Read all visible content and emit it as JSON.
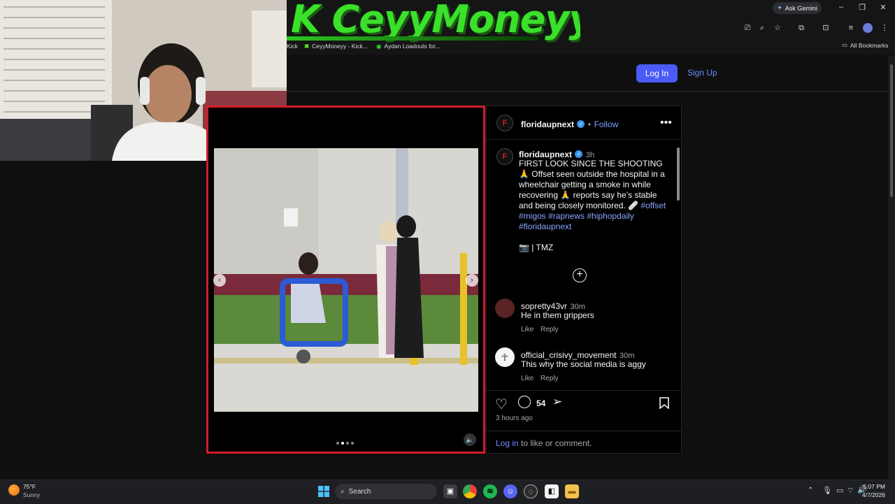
{
  "browser": {
    "banner_text": "K CeyyMoneyy",
    "bookmarks": [
      "Kick",
      "CeyyMoneyy - Kick...",
      "Aydan Loadouts for..."
    ],
    "ask_gemini": "Ask Gemini",
    "all_bookmarks": "All Bookmarks"
  },
  "header": {
    "login_label": "Log In",
    "signup_label": "Sign Up"
  },
  "post": {
    "username": "floridaupnext",
    "follow_label": "Follow",
    "caption_user": "floridaupnext",
    "caption_time": "3h",
    "caption_text": "FIRST LOOK SINCE THE SHOOTING 🙏 Offset seen outside the hospital in a wheelchair getting a smoke in while recovering 🙏 reports say he’s stable and being closely monitored. 🩹",
    "hashtags": "#offset #migos #rapnews #hiphopdaily #floridaupnext",
    "credit": "📷 | TMZ",
    "comments": [
      {
        "user": "sopretty43vr",
        "time": "30m",
        "text": "He in them grippers",
        "like": "Like",
        "reply": "Reply"
      },
      {
        "user": "official_crisivy_movement",
        "time": "30m",
        "text": "This why the social media is aggy",
        "like": "Like",
        "reply": "Reply"
      }
    ],
    "comment_count": "54",
    "posted_ago": "3 hours ago",
    "login_link": "Log in",
    "login_suffix": " to like or comment.",
    "carousel_index": 2,
    "carousel_total": 4
  },
  "taskbar": {
    "weather_temp": "75°F",
    "weather_cond": "Sunny",
    "search_label": "Search",
    "time": "5:07 PM",
    "date": "4/7/2026"
  },
  "colors": {
    "accent": "#4a5cf5",
    "highlight_border": "#d01c2a",
    "banner_green": "#3be02a"
  }
}
